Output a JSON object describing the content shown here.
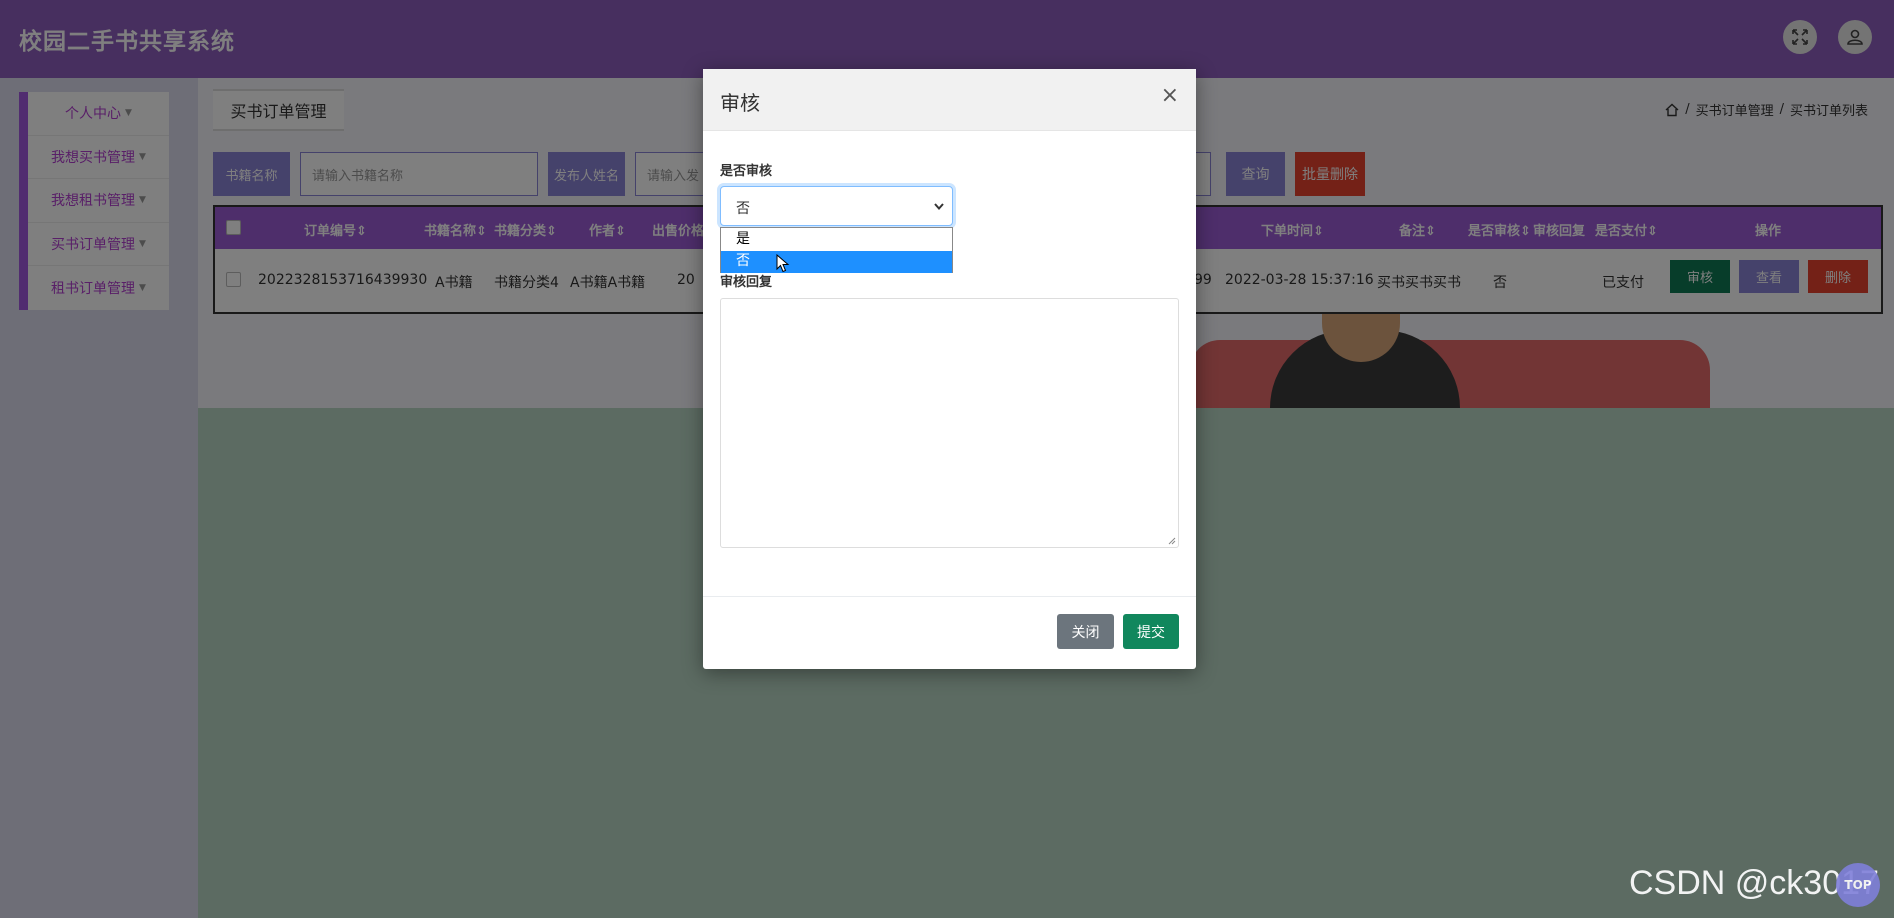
{
  "header": {
    "app_title": "校园二手书共享系统",
    "fullscreen_icon": "fullscreen-icon",
    "user_icon": "user-icon"
  },
  "sidebar": {
    "items": [
      {
        "label": "个人中心"
      },
      {
        "label": "我想买书管理"
      },
      {
        "label": "我想租书管理"
      },
      {
        "label": "买书订单管理"
      },
      {
        "label": "租书订单管理"
      }
    ]
  },
  "tab": {
    "label": "买书订单管理"
  },
  "breadcrumb": {
    "items": [
      "买书订单管理",
      "买书订单列表"
    ],
    "separator": "/"
  },
  "search": {
    "book_name_label": "书籍名称",
    "book_name_placeholder": "请输入书籍名称",
    "publisher_label": "发布人姓名",
    "publisher_placeholder": "请输入发",
    "query_button": "查询",
    "batch_delete_button": "批量删除"
  },
  "table": {
    "columns": [
      "订单编号",
      "书籍名称",
      "书籍分类",
      "作者",
      "出售价格",
      "下单时间",
      "备注",
      "是否审核",
      "审核回复",
      "是否支付",
      "操作"
    ],
    "rows": [
      {
        "order_no": "2022328153716439930",
        "book_name": "A书籍",
        "category": "书籍分类4",
        "author": "A书籍A书籍",
        "price": "20",
        "partial_value": "99",
        "order_time": "2022-03-28 15:37:16",
        "remark": "买书买书买书",
        "reviewed": "否",
        "paid": "已支付",
        "actions": {
          "review": "审核",
          "view": "查看",
          "delete": "删除"
        }
      }
    ]
  },
  "modal": {
    "title": "审核",
    "close_glyph": "×",
    "review_label": "是否审核",
    "select_value": "否",
    "options": [
      "是",
      "否"
    ],
    "highlighted_option": "否",
    "reply_label": "审核回复",
    "close_button": "关闭",
    "submit_button": "提交"
  },
  "watermark": "CSDN @ck3017",
  "top_button": "TOP",
  "colors": {
    "header": "#8f5fbf",
    "accent": "#9d5cd6",
    "primary_btn": "#8b84d7",
    "danger": "#e8432e",
    "success": "#0f7a55"
  }
}
